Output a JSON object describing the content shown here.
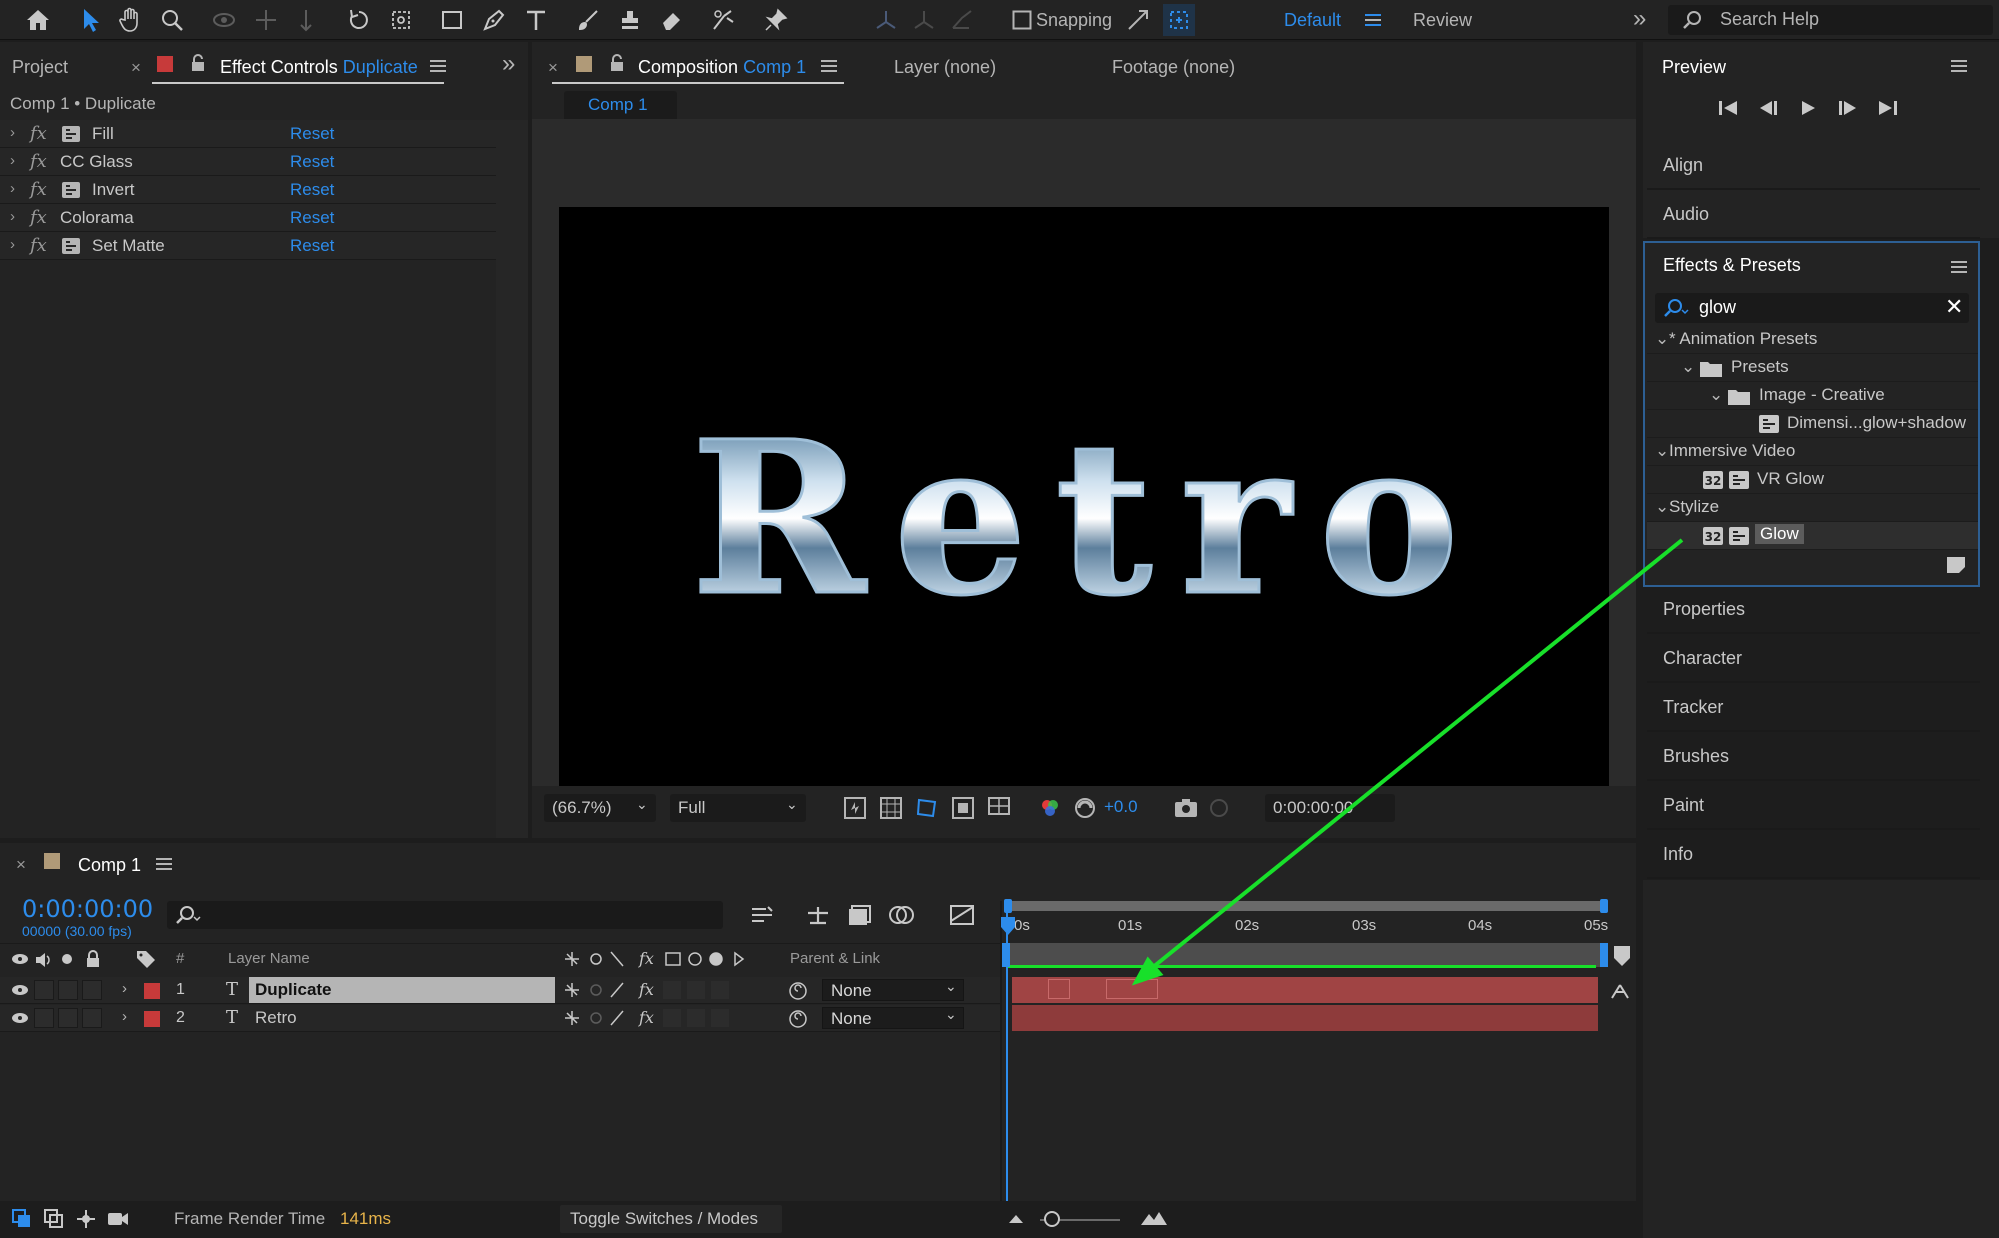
{
  "toolbar": {
    "snapping_label": "Snapping",
    "workspace_active": "Default",
    "workspace_other": "Review",
    "search_placeholder": "Search Help"
  },
  "effect_controls": {
    "project_tab": "Project",
    "tab_label": "Effect Controls",
    "tab_target": "Duplicate",
    "breadcrumb": "Comp 1 • Duplicate",
    "reset_label": "Reset",
    "effects": [
      "Fill",
      "CC Glass",
      "Invert",
      "Colorama",
      "Set Matte"
    ]
  },
  "composition": {
    "tab_label": "Composition",
    "tab_target": "Comp 1",
    "layer_tab": "Layer (none)",
    "footage_tab": "Footage (none)",
    "subtab": "Comp 1",
    "canvas_text": "Retro",
    "zoom": "(66.7%)",
    "resolution": "Full",
    "exposure": "+0.0",
    "timecode": "0:00:00:00"
  },
  "right_panel": {
    "preview_title": "Preview",
    "align": "Align",
    "audio": "Audio",
    "effects_presets_title": "Effects & Presets",
    "search_value": "glow",
    "tree": {
      "animation_presets": "* Animation Presets",
      "presets": "Presets",
      "image_creative": "Image - Creative",
      "dimensional": "Dimensi...glow+shadow",
      "immersive_video": "Immersive Video",
      "vr_glow": "VR Glow",
      "stylize": "Stylize",
      "glow": "Glow"
    },
    "properties": "Properties",
    "character": "Character",
    "tracker": "Tracker",
    "brushes": "Brushes",
    "paint": "Paint",
    "info": "Info"
  },
  "timeline": {
    "comp_tab": "Comp 1",
    "current_time": "0:00:00:00",
    "frame_info": "00000 (30.00 fps)",
    "col_num": "#",
    "col_layer_name": "Layer Name",
    "col_parent": "Parent & Link",
    "ruler": [
      "0s",
      "01s",
      "02s",
      "03s",
      "04s",
      "05s"
    ],
    "layers": [
      {
        "num": "1",
        "name": "Duplicate",
        "parent": "None",
        "selected": true
      },
      {
        "num": "2",
        "name": "Retro",
        "parent": "None",
        "selected": false
      }
    ],
    "frame_render_label": "Frame Render Time",
    "frame_render_value": "141ms",
    "toggle_label": "Toggle Switches / Modes"
  },
  "colors": {
    "accent": "#2d8ceb",
    "label_red": "#c73a3a",
    "annotation_arrow": "#18e02a",
    "track_bar": "#a04444"
  }
}
